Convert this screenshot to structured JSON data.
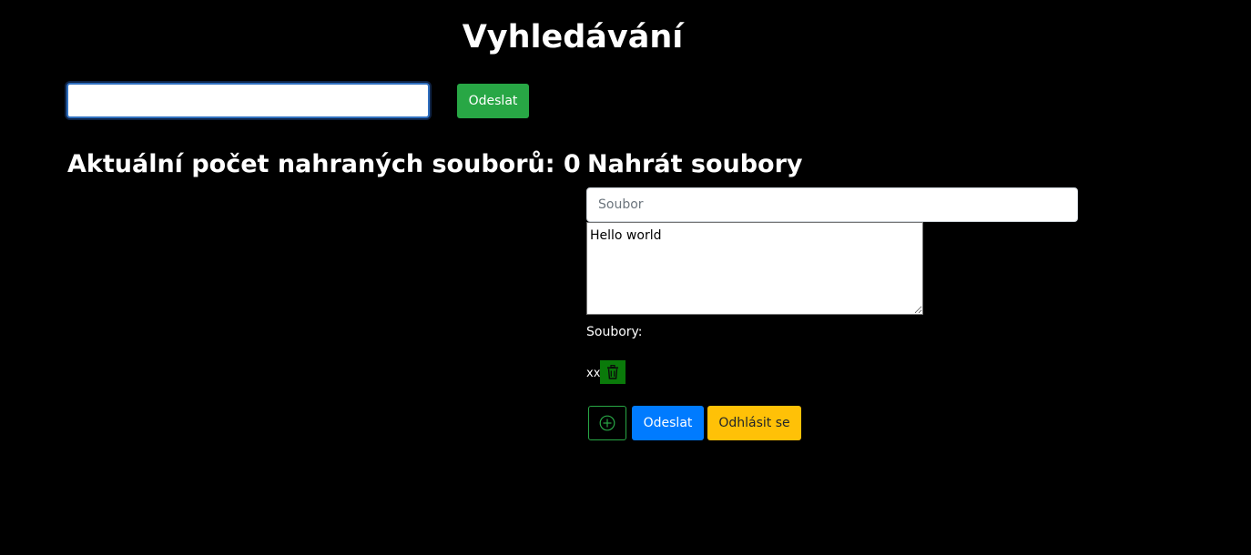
{
  "search": {
    "title": "Vyhledávání",
    "input_value": "",
    "submit_label": "Odeslat"
  },
  "stats": {
    "count_heading": "Aktuální počet nahraných souborů: 0"
  },
  "upload": {
    "heading": "Nahrát soubory",
    "file_placeholder": "Soubor",
    "content_value": "Hello world",
    "files_label": "Soubory:",
    "files": [
      {
        "name": "xx",
        "delete_icon": "trash-icon"
      }
    ],
    "add_icon": "plus-circle-icon",
    "submit_label": "Odeslat",
    "logout_label": "Odhlásit se"
  },
  "colors": {
    "background": "#000000",
    "success": "#28a745",
    "primary": "#007bff",
    "warning": "#ffc107",
    "delete_bg": "#0a7a0a"
  }
}
